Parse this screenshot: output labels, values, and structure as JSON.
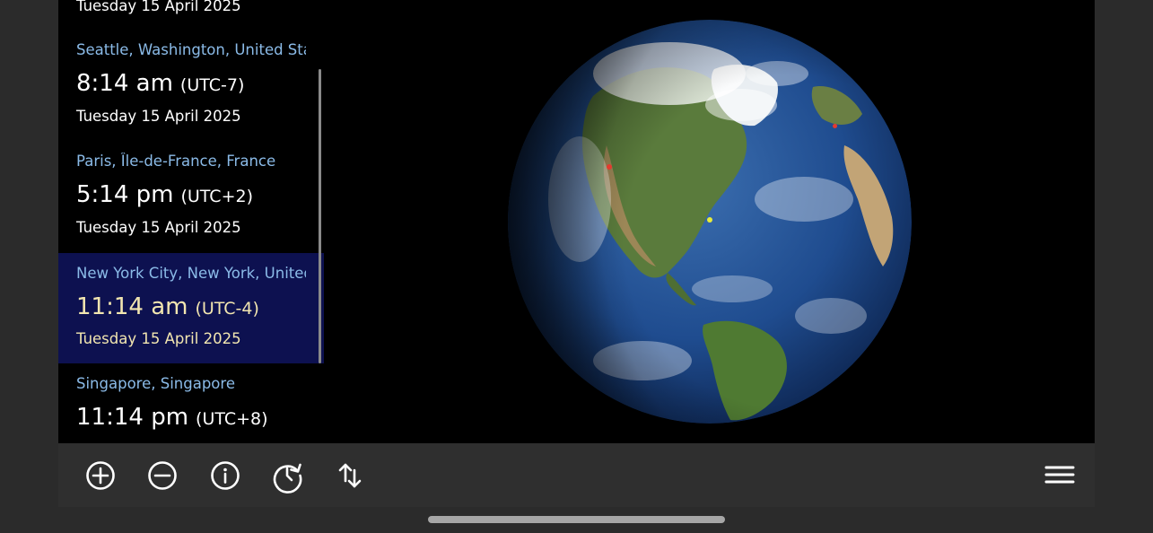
{
  "entries": [
    {
      "location": "",
      "time": "",
      "utc": "",
      "date": "Tuesday 15 April 2025"
    },
    {
      "location": "Seattle, Washington, United States",
      "time": "8:14 am",
      "utc": "(UTC-7)",
      "date": "Tuesday 15 April 2025"
    },
    {
      "location": "Paris, Île-de-France, France",
      "time": "5:14 pm",
      "utc": "(UTC+2)",
      "date": "Tuesday 15 April 2025"
    },
    {
      "location": "New York City, New York, United States",
      "time": "11:14 am",
      "utc": "(UTC-4)",
      "date": "Tuesday 15 April 2025",
      "selected": true
    },
    {
      "location": "Singapore, Singapore",
      "time": "11:14 pm",
      "utc": "(UTC+8)",
      "date": ""
    }
  ],
  "toolbar": {
    "buttons": [
      {
        "icon": "plus-circle-icon"
      },
      {
        "icon": "minus-circle-icon"
      },
      {
        "icon": "info-circle-icon"
      },
      {
        "icon": "clock-reset-icon"
      },
      {
        "icon": "sort-arrows-icon"
      }
    ],
    "menu_icon": "hamburger-menu-icon"
  },
  "colors": {
    "location_text": "#8bbbe8",
    "selected_background": "#0d1150",
    "selected_text": "#f2e6b0",
    "toolbar_background": "#2f2f2f"
  }
}
